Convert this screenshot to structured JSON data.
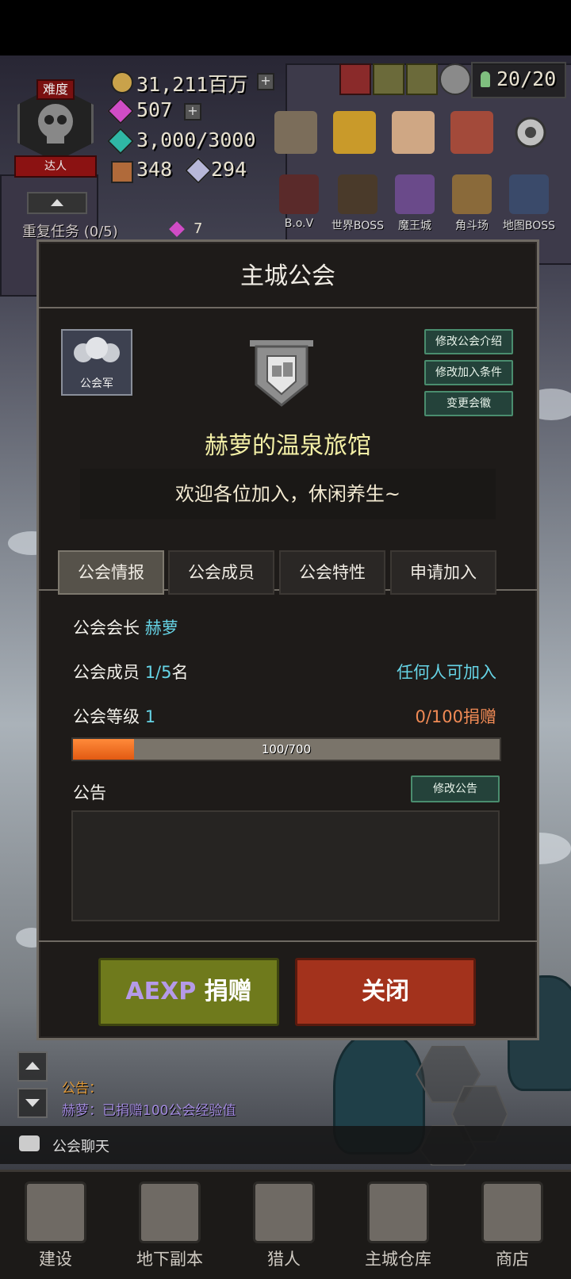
{
  "hud": {
    "difficulty_label": "难度",
    "rank_label": "达人",
    "gold": "31,211百万",
    "gems": "507",
    "stamina": "3,000/3000",
    "chest_count": "348",
    "crystal_count": "294",
    "population": "20/20",
    "repeat_task": "重复任务 (0/5)",
    "repeat_task_reward": "7"
  },
  "features": [
    {
      "label": "B.o.V"
    },
    {
      "label": "世界BOSS"
    },
    {
      "label": "魔王城"
    },
    {
      "label": "角斗场"
    },
    {
      "label": "地图BOSS"
    }
  ],
  "modal": {
    "title": "主城公会",
    "emblem_badge_label": "公会军",
    "buttons": {
      "edit_intro": "修改公会介绍",
      "edit_join": "修改加入条件",
      "change_emblem": "变更会徽",
      "edit_notice": "修改公告",
      "donate_prefix": "AEXP",
      "donate_suffix": " 捐赠",
      "close": "关闭"
    },
    "guild_name": "赫萝的温泉旅馆",
    "guild_intro": "欢迎各位加入，休闲养生~",
    "tabs": [
      {
        "label": "公会情报",
        "active": true
      },
      {
        "label": "公会成员",
        "active": false
      },
      {
        "label": "公会特性",
        "active": false
      },
      {
        "label": "申请加入",
        "active": false
      }
    ],
    "info": {
      "leader_label": "公会会长",
      "leader_name": "赫萝",
      "members_label": "公会成员",
      "members_value": "1/5",
      "members_unit": "名",
      "join_policy": "任何人可加入",
      "level_label": "公会等级",
      "level_value": "1",
      "donation_status": "0/100捐赠",
      "exp_text": "100/700",
      "exp_fraction": 0.1429,
      "notice_label": "公告",
      "notice_text": ""
    }
  },
  "chat": {
    "notice_prefix": "公告：",
    "last_message": "赫萝：已捐赠100公会经验值",
    "channel": "公会聊天"
  },
  "bottom_nav": [
    {
      "label": "建设"
    },
    {
      "label": "地下副本"
    },
    {
      "label": "猎人"
    },
    {
      "label": "主城仓库"
    },
    {
      "label": "商店"
    }
  ],
  "colors": {
    "accent_cyan": "#66d4e6",
    "accent_orange": "#f08a55",
    "donate_button": "#6f7a1c",
    "close_button": "#a3321c",
    "guild_name": "#f3efa6"
  }
}
